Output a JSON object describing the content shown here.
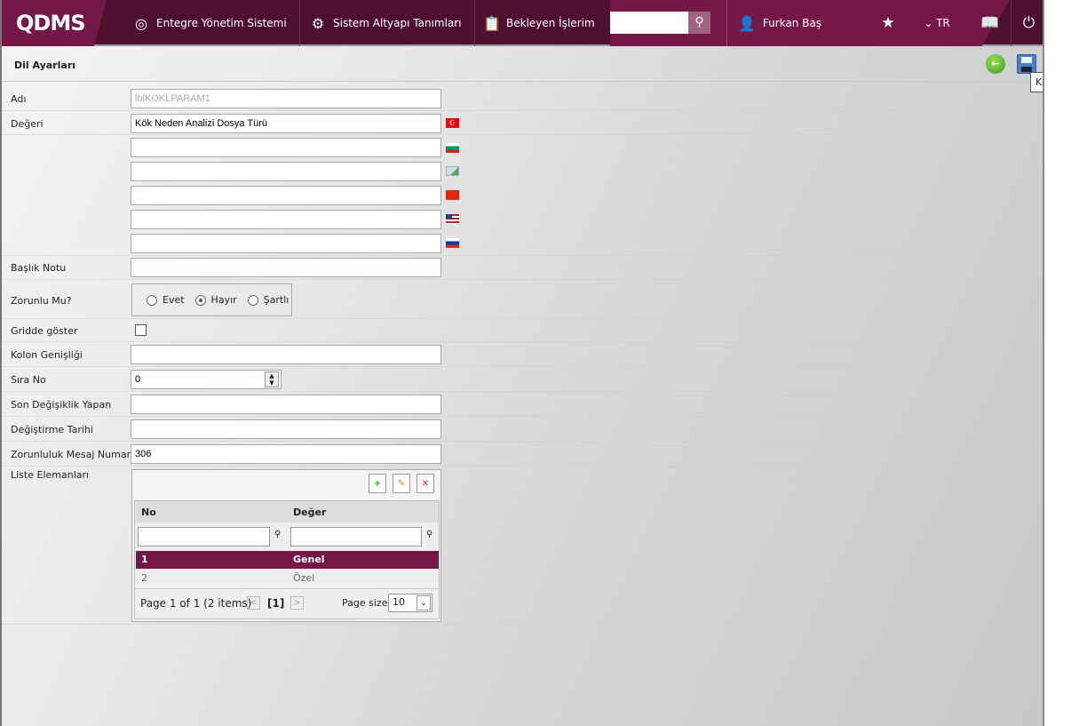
{
  "header": {
    "logo": "QDMS",
    "nav": [
      {
        "label": "Entegre Yönetim Sistemi"
      },
      {
        "label": "Sistem Altyapı Tanımları"
      },
      {
        "label": "Bekleyen İşlerim"
      }
    ],
    "search_value": "",
    "user": "Furkan Baş",
    "language": "TR"
  },
  "page": {
    "title": "Dil Ayarları",
    "tooltip": "Kaydet"
  },
  "form": {
    "adi_label": "Adı",
    "adi_value": "lblKOKLPARAM1",
    "degeri_label": "Değeri",
    "degeri_values": [
      "Kök Neden Analizi Dosya Türü",
      "",
      "",
      "",
      "",
      ""
    ],
    "baslik_label": "Başlık Notu",
    "baslik_value": "",
    "zorunlu_label": "Zorunlu Mu?",
    "zorunlu_options": [
      "Evet",
      "Hayır",
      "Şartlı"
    ],
    "zorunlu_selected": "Hayır",
    "gridde_label": "Gridde göster",
    "gridde_checked": false,
    "kolon_label": "Kolon Genişliği",
    "kolon_value": "",
    "sira_label": "Sıra No",
    "sira_value": "0",
    "son_label": "Son Değişiklik Yapan",
    "son_value": "",
    "tarih_label": "Değiştirme Tarihi",
    "tarih_value": "",
    "mesaj_label": "Zorunluluk Mesaj Numarası",
    "mesaj_value": "306",
    "liste_label": "Liste Elemanları"
  },
  "grid": {
    "columns": [
      "No",
      "Değer"
    ],
    "rows": [
      {
        "no": "1",
        "deger": "Genel"
      },
      {
        "no": "2",
        "deger": "Özel"
      }
    ],
    "pager": "Page 1 of 1 (2 items)",
    "current_page": "[1]",
    "page_size_label": "Page size:",
    "page_size": "10"
  },
  "colors": {
    "brand": "#751848",
    "dark": "#4e1030"
  }
}
